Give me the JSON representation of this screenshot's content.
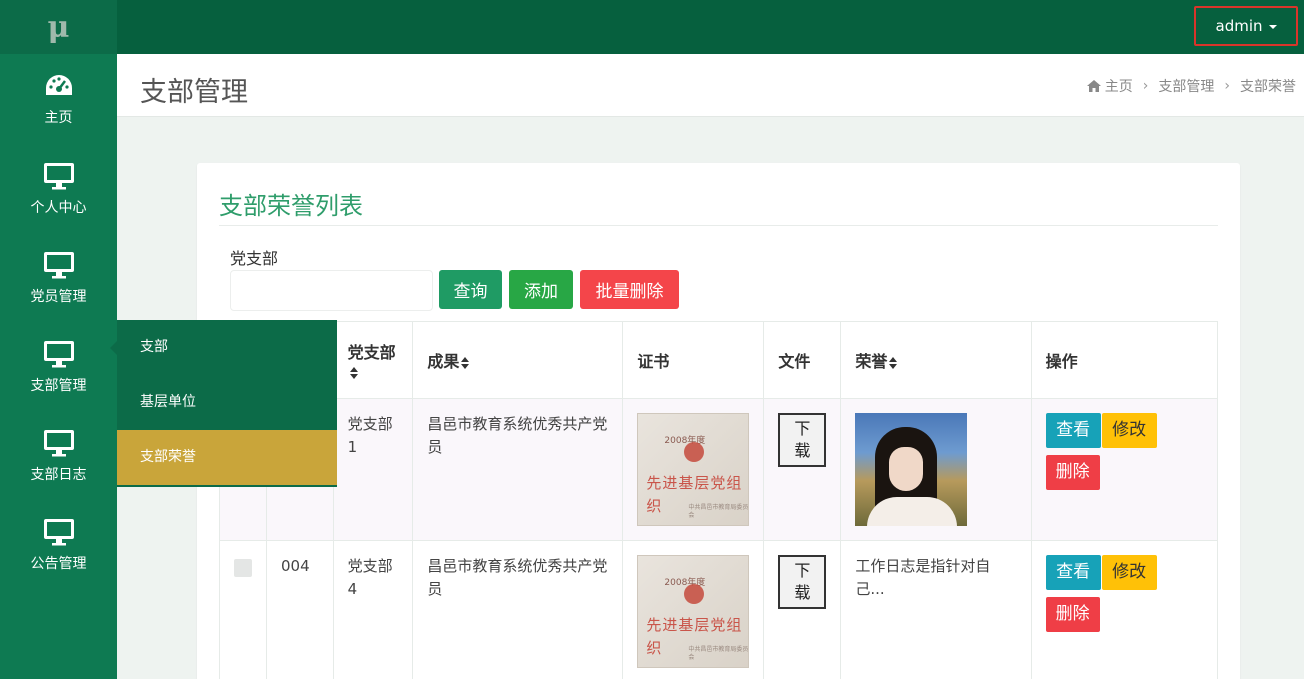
{
  "logo": "μ",
  "sidebar": {
    "items": [
      {
        "label": "主页",
        "icon": "dashboard-icon"
      },
      {
        "label": "个人中心",
        "icon": "monitor-icon"
      },
      {
        "label": "党员管理",
        "icon": "monitor-icon"
      },
      {
        "label": "支部管理",
        "icon": "monitor-icon"
      },
      {
        "label": "支部日志",
        "icon": "monitor-icon"
      },
      {
        "label": "公告管理",
        "icon": "monitor-icon"
      }
    ],
    "submenu": {
      "parent": "支部管理",
      "items": [
        {
          "label": "支部",
          "active": false
        },
        {
          "label": "基层单位",
          "active": false
        },
        {
          "label": "支部荣誉",
          "active": true
        }
      ]
    }
  },
  "topbar": {
    "user": "admin"
  },
  "header": {
    "title": "支部管理",
    "breadcrumb": {
      "home": "主页",
      "parent": "支部管理",
      "current": "支部荣誉"
    }
  },
  "card": {
    "title": "支部荣誉列表",
    "filter": {
      "label": "党支部",
      "value": "",
      "placeholder": ""
    },
    "buttons": {
      "query": "查询",
      "add": "添加",
      "batch_delete": "批量删除"
    }
  },
  "table": {
    "columns": {
      "branch": "党支部",
      "result": "成果",
      "certificate": "证书",
      "file": "文件",
      "honor": "荣誉",
      "actions": "操作"
    },
    "rows": [
      {
        "id": "",
        "branch": "党支部1",
        "result": "昌邑市教育系统优秀共产党员",
        "file_btn": "下载",
        "honor_type": "image",
        "honor": ""
      },
      {
        "id": "004",
        "branch": "党支部4",
        "result": "昌邑市教育系统优秀共产党员",
        "file_btn": "下载",
        "honor_type": "text",
        "honor": "工作日志是指针对自己..."
      }
    ],
    "actions": {
      "view": "查看",
      "edit": "修改",
      "delete": "删除"
    },
    "certificate_text": {
      "year": "2008年度",
      "main": "先进基层党组织",
      "issuer": "中共昌邑市教育局委员会"
    }
  },
  "colors": {
    "sidebar": "#0e7a52",
    "topbar": "#06603e",
    "accent": "#2f9d6b",
    "active_sub": "#c9a53a",
    "danger": "#f4454a",
    "warning": "#ffc107",
    "info": "#17a2b8"
  }
}
